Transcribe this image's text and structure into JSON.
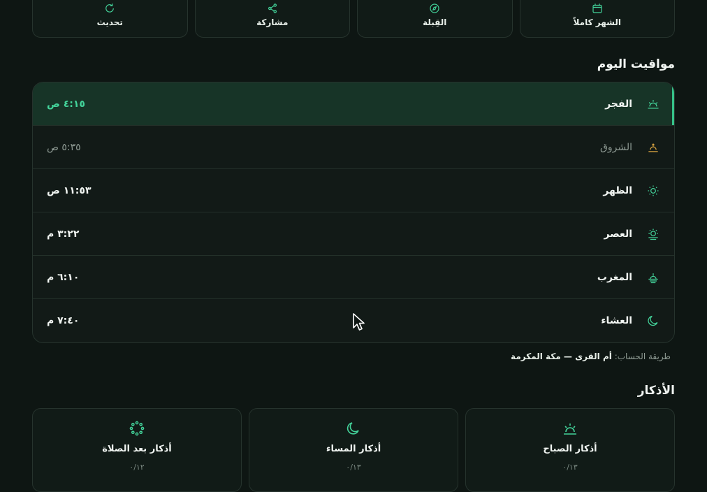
{
  "actions": [
    {
      "label": "الشهر كاملاً",
      "icon": "calendar-icon"
    },
    {
      "label": "القِبلة",
      "icon": "compass-icon"
    },
    {
      "label": "مشاركة",
      "icon": "share-icon"
    },
    {
      "label": "تحديث",
      "icon": "refresh-icon"
    }
  ],
  "today": {
    "title": "مواقيت اليوم",
    "prayers": [
      {
        "name": "الفجر",
        "time": "٤:١٥ ص",
        "icon": "sunrise-icon",
        "state": "active"
      },
      {
        "name": "الشروق",
        "time": "٥:٣٥ ص",
        "icon": "sun-up-icon",
        "state": "dim"
      },
      {
        "name": "الظهر",
        "time": "١١:٥٣ ص",
        "icon": "sun-icon",
        "state": "normal"
      },
      {
        "name": "العصر",
        "time": "٣:٢٢ م",
        "icon": "sun-low-icon",
        "state": "normal"
      },
      {
        "name": "المغرب",
        "time": "٦:١٠ م",
        "icon": "sunset-icon",
        "state": "normal"
      },
      {
        "name": "العشاء",
        "time": "٧:٤٠ م",
        "icon": "moon-icon",
        "state": "normal"
      }
    ],
    "method_label": "طريقة الحساب:",
    "method_value": "أم القرى — مكة المكرمة"
  },
  "azkar": {
    "title": "الأذكار",
    "cards": [
      {
        "title": "أذكار الصباح",
        "count": "٠/١٣",
        "icon": "morning-sun-icon"
      },
      {
        "title": "أذكار المساء",
        "count": "٠/١٣",
        "icon": "crescent-icon"
      },
      {
        "title": "أذكار بعد الصلاة",
        "count": "٠/١٢",
        "icon": "tasbih-icon"
      }
    ]
  },
  "colors": {
    "accent": "#36c38a",
    "background": "#0e1613",
    "card": "#121a17"
  }
}
